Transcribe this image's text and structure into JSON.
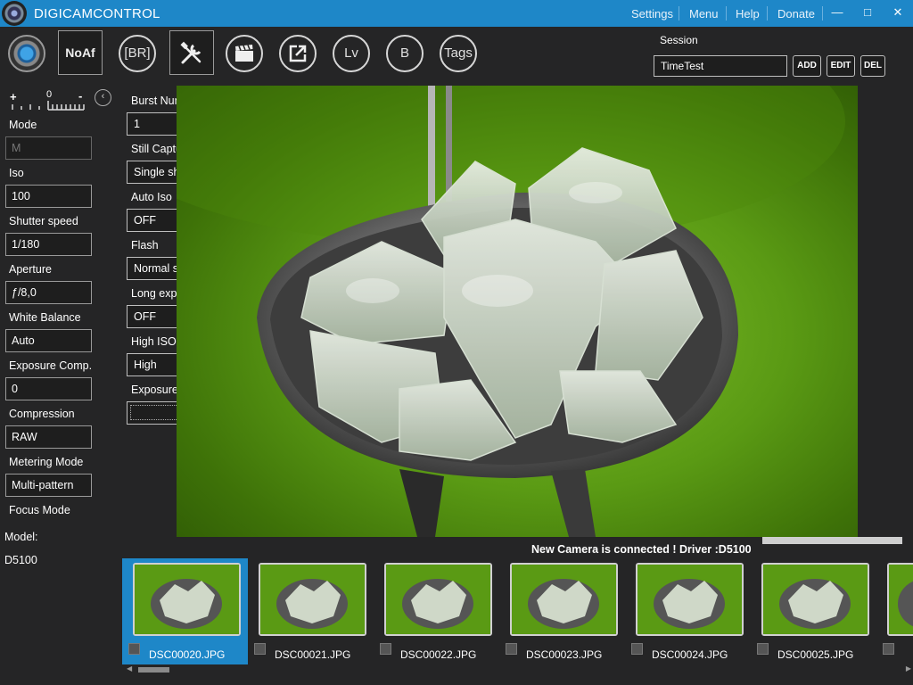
{
  "title_bar": {
    "app_title": "DIGICAMCONTROL",
    "menu": [
      "Settings",
      "Menu",
      "Help",
      "Donate"
    ],
    "min_glyph": "—",
    "max_glyph": "□",
    "close_glyph": "✕"
  },
  "toolbar": {
    "buttons": [
      {
        "icon": "capture-icon",
        "label": ""
      },
      {
        "icon": "noaf-icon",
        "label": "NoAf"
      },
      {
        "icon": "bracketing-icon",
        "label": "[BR]"
      },
      {
        "icon": "tools-icon",
        "label": ""
      },
      {
        "icon": "movie-clapper-icon",
        "label": ""
      },
      {
        "icon": "external-link-icon",
        "label": ""
      },
      {
        "icon": "liveview-icon",
        "label": "Lv"
      },
      {
        "icon": "bulb-icon",
        "label": "B"
      },
      {
        "icon": "tags-icon",
        "label": "Tags"
      }
    ]
  },
  "session": {
    "label": "Session",
    "value": "TimeTest",
    "add": "ADD",
    "edit": "EDIT",
    "del": "DEL"
  },
  "exposure_scale": {
    "plus": "+",
    "zero": "0",
    "minus": "-"
  },
  "camera_settings": [
    {
      "label": "Mode",
      "value": "M",
      "disabled": true
    },
    {
      "label": "Iso",
      "value": "100"
    },
    {
      "label": "Shutter speed",
      "value": "1/180"
    },
    {
      "label": "Aperture",
      "value": "ƒ/8,0"
    },
    {
      "label": "White Balance",
      "value": "Auto"
    },
    {
      "label": "Exposure Comp.",
      "value": "0"
    },
    {
      "label": "Compression",
      "value": "RAW"
    },
    {
      "label": "Metering Mode",
      "value": "Multi-pattern"
    },
    {
      "label": "Focus Mode",
      "value": ""
    }
  ],
  "model": {
    "label": "Model:",
    "value": "D5100"
  },
  "advanced_settings": [
    {
      "label": "Burst Number",
      "value": "1"
    },
    {
      "label": "Still Capture Moc",
      "value": "Single shot (si"
    },
    {
      "label": "Auto Iso",
      "value": "OFF"
    },
    {
      "label": "Flash",
      "value": "Normal synch"
    },
    {
      "label": "Long exp. NR",
      "value": "OFF"
    },
    {
      "label": "High ISO NR",
      "value": "High"
    },
    {
      "label": "Exposure delay m",
      "value": ""
    }
  ],
  "status": {
    "message": "New Camera is connected ! Driver :D5100",
    "progress": 1.0
  },
  "thumbnails": [
    {
      "name": "DSC00020.JPG",
      "selected": true
    },
    {
      "name": "DSC00021.JPG",
      "selected": false
    },
    {
      "name": "DSC00022.JPG",
      "selected": false
    },
    {
      "name": "DSC00023.JPG",
      "selected": false
    },
    {
      "name": "DSC00024.JPG",
      "selected": false
    },
    {
      "name": "DSC00025.JPG",
      "selected": false
    }
  ],
  "colors": {
    "accent": "#1e87c8",
    "background": "#252526",
    "preview_green": "#5a9a14"
  }
}
